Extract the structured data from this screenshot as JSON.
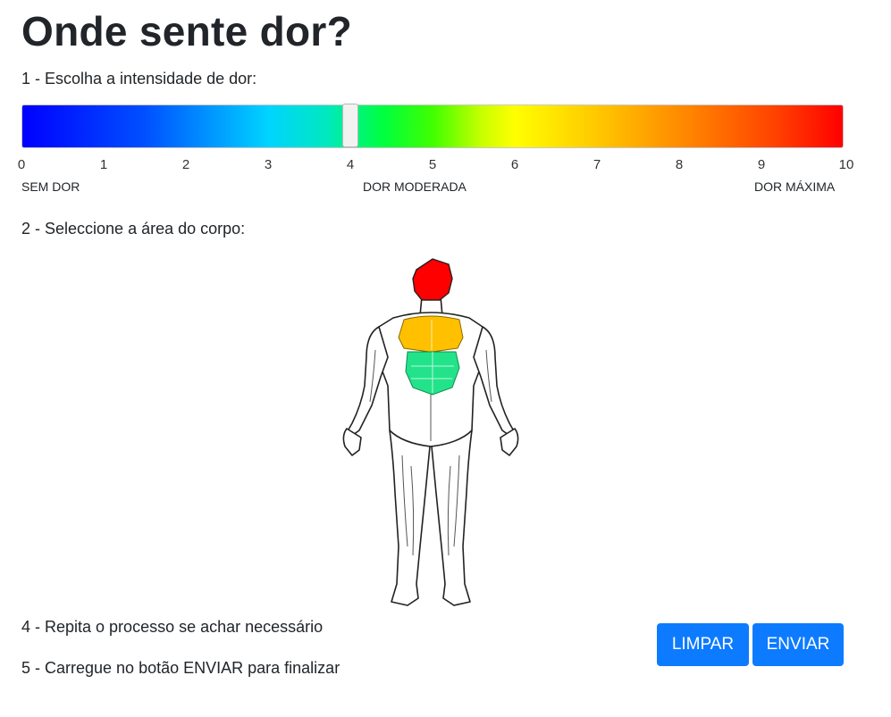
{
  "page": {
    "title": "Onde sente dor?",
    "step1": "1 - Escolha a intensidade de dor:",
    "step2": "2 - Seleccione a área do corpo:",
    "step4": "4 - Repita o processo se achar necessário",
    "step5": "5 - Carregue no botão ENVIAR para finalizar"
  },
  "pain_scale": {
    "value": 4,
    "min": 0,
    "max": 10,
    "ticks": [
      "0",
      "1",
      "2",
      "3",
      "4",
      "5",
      "6",
      "7",
      "8",
      "9",
      "10"
    ],
    "labels": {
      "min": "SEM DOR",
      "mid": "DOR MODERADA",
      "max": "DOR MÁXIMA"
    }
  },
  "body_map": {
    "selected_regions": [
      {
        "region": "head",
        "color": "#ff0000"
      },
      {
        "region": "chest",
        "color": "#ffc000"
      },
      {
        "region": "abdomen",
        "color": "#22e38a"
      }
    ]
  },
  "buttons": {
    "clear": "LIMPAR",
    "submit": "ENVIAR",
    "color": "#0d7bff"
  }
}
